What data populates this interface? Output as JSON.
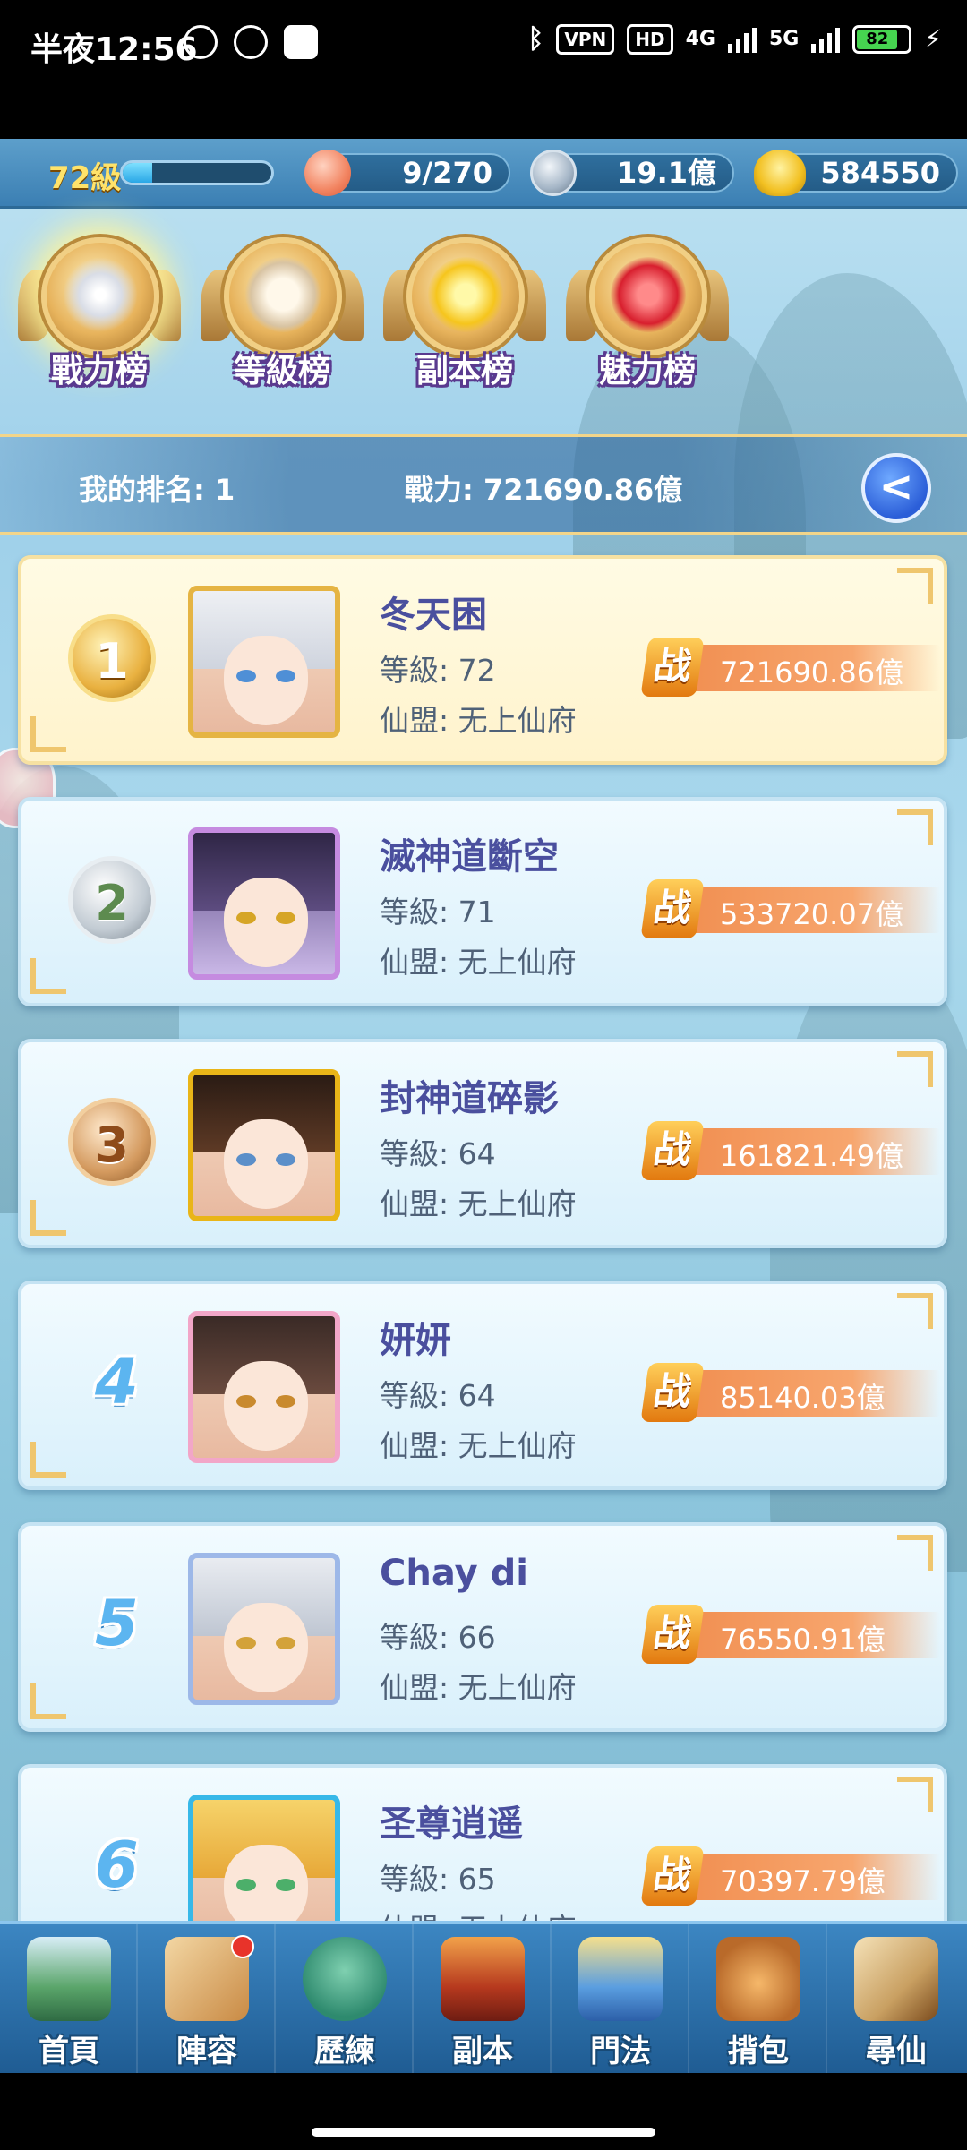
{
  "status_bar": {
    "time": "半夜12:56",
    "vpn": "VPN",
    "hd": "HD",
    "net1": "4G",
    "net2": "5G",
    "battery": "82"
  },
  "resources": {
    "level": "72級",
    "xp_progress": 0.2,
    "stamina": "9/270",
    "silver": "19.1億",
    "gold": "584550"
  },
  "tabs": [
    {
      "label": "戰力榜",
      "active": true
    },
    {
      "label": "等級榜",
      "active": false
    },
    {
      "label": "副本榜",
      "active": false
    },
    {
      "label": "魅力榜",
      "active": false
    }
  ],
  "my_rank": {
    "rank_text": "我的排名: 1",
    "power_text": "戰力: 721690.86億"
  },
  "rankings": [
    {
      "rank": "1",
      "name": "冬天困",
      "level": "等級: 72",
      "guild": "仙盟: 无上仙府",
      "power_icon": "战",
      "power": "721690.86億"
    },
    {
      "rank": "2",
      "name": "滅神道斷空",
      "level": "等級: 71",
      "guild": "仙盟: 无上仙府",
      "power_icon": "战",
      "power": "533720.07億"
    },
    {
      "rank": "3",
      "name": "封神道碎影",
      "level": "等級: 64",
      "guild": "仙盟: 无上仙府",
      "power_icon": "战",
      "power": "161821.49億"
    },
    {
      "rank": "4",
      "name": "妍妍",
      "level": "等級: 64",
      "guild": "仙盟: 无上仙府",
      "power_icon": "战",
      "power": "85140.03億"
    },
    {
      "rank": "5",
      "name": "Chay di",
      "level": "等級: 66",
      "guild": "仙盟: 无上仙府",
      "power_icon": "战",
      "power": "76550.91億"
    },
    {
      "rank": "6",
      "name": "圣尊逍遥",
      "level": "等級: 65",
      "guild": "仙盟: 无上仙府",
      "power_icon": "战",
      "power": "70397.79億"
    }
  ],
  "bottom_nav": [
    {
      "label": "首頁",
      "icon": "home-island-icon"
    },
    {
      "label": "陣容",
      "icon": "lineup-cards-icon",
      "badge": true
    },
    {
      "label": "歷練",
      "icon": "training-gourd-icon"
    },
    {
      "label": "副本",
      "icon": "dungeon-gate-icon"
    },
    {
      "label": "門法",
      "icon": "sect-sword-icon"
    },
    {
      "label": "揹包",
      "icon": "backpack-bag-icon"
    },
    {
      "label": "尋仙",
      "icon": "seek-scroll-icon"
    }
  ],
  "colors": {
    "accent_gold": "#f2d58a",
    "name_text": "#4a4f9e",
    "power_bar": "#f08a4b"
  }
}
